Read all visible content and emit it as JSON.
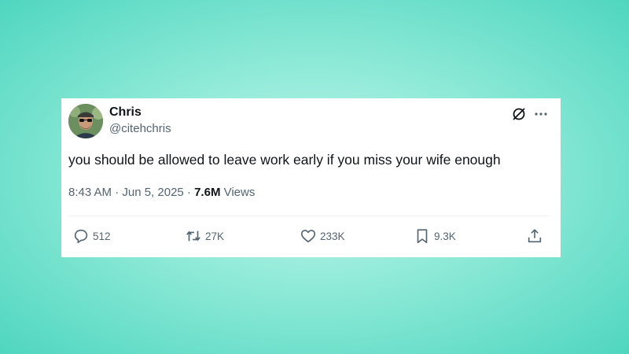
{
  "tweet": {
    "author_name": "Chris",
    "author_handle": "@citehchris",
    "text": "you should be allowed to leave work early if you miss your wife enough",
    "timestamp": "8:43 AM · Jun 5, 2025 · ",
    "views_count": "7.6M",
    "views_label": " Views"
  },
  "actions": {
    "replies": "512",
    "reposts": "27K",
    "likes": "233K",
    "bookmarks": "9.3K"
  },
  "colors": {
    "text_primary": "#0f1419",
    "text_secondary": "#536471",
    "background": "#4fd6c0"
  },
  "icons": [
    "grok-icon",
    "more-icon",
    "reply-icon",
    "repost-icon",
    "like-icon",
    "bookmark-icon",
    "share-icon"
  ]
}
